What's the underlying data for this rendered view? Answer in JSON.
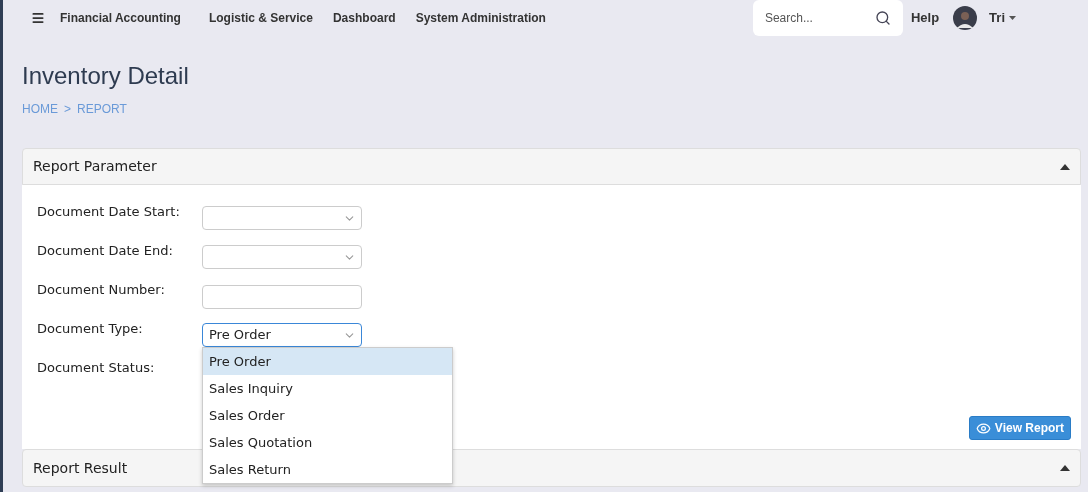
{
  "nav": {
    "menu": [
      "Financial Accounting",
      "Logistic & Service",
      "Dashboard",
      "System Administration"
    ],
    "search": {
      "placeholder": "Search..."
    },
    "help": "Help",
    "user": "Tri"
  },
  "page": {
    "title": "Inventory Detail",
    "breadcrumb": [
      "HOME",
      ">",
      "REPORT"
    ]
  },
  "parameter_panel": {
    "title": "Report Parameter",
    "expanded": true,
    "fields": [
      {
        "label": "Document Date Start:",
        "kind": "date"
      },
      {
        "label": "Document Date End:",
        "kind": "date"
      },
      {
        "label": "Document Number:",
        "kind": "text"
      },
      {
        "label": "Document Type:",
        "kind": "select",
        "value": "Pre Order",
        "focused": true,
        "open": true,
        "options": [
          {
            "label": "Pre Order",
            "selected": true
          },
          {
            "label": "Sales Inquiry",
            "selected": false
          },
          {
            "label": "Sales Order",
            "selected": false
          },
          {
            "label": "Sales Quotation",
            "selected": false
          },
          {
            "label": "Sales Return",
            "selected": false
          }
        ]
      },
      {
        "label": "Document Status:",
        "kind": "hidden"
      }
    ],
    "button": "View Report"
  },
  "result_panel": {
    "title": "Report Result",
    "expanded": true
  }
}
